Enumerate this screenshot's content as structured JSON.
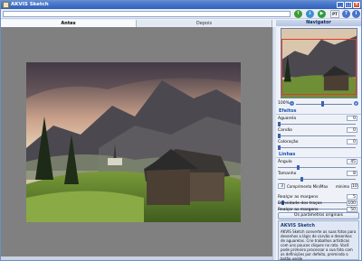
{
  "window": {
    "title": "AKVIS Sketch"
  },
  "toolbar": {
    "path_value": "",
    "pt_label": "PT"
  },
  "tabs": {
    "before": "Antes",
    "after": "Depois"
  },
  "navigator": {
    "title": "Navigator"
  },
  "zoom": {
    "level": "100%",
    "level_fraction": 0.46
  },
  "effects": {
    "title": "Efeitos",
    "params": [
      {
        "label": "Aguarela",
        "value": "0",
        "fraction": 0.0
      },
      {
        "label": "Carvão",
        "value": "0",
        "fraction": 0.0
      },
      {
        "label": "Coloração",
        "value": "0",
        "fraction": 0.0
      }
    ]
  },
  "lines": {
    "title": "Linhas",
    "params": [
      {
        "label": "Ângulo",
        "value": "45",
        "fraction": 0.25
      },
      {
        "label": "Tamanho",
        "value": "8",
        "fraction": 0.3
      }
    ],
    "length_row": {
      "min_value": "3",
      "label": "Comprimento Min/Max",
      "max_label": "mínimo",
      "max_value": "10"
    },
    "more_params": [
      {
        "label": "Realçar as margens",
        "value": "5",
        "fraction": 0.05
      },
      {
        "label": "Densidade dos traços",
        "value": "100",
        "fraction": 1.0
      },
      {
        "label": "Realçar as margens",
        "value": "50",
        "fraction": 0.5
      }
    ]
  },
  "restore_button": "Os parâmetros originais",
  "help": {
    "title": "AKVIS Sketch",
    "text": "AKVIS Sketch converte as suas fotos para desenhos a lápis de carvão e desenhos de aguarelas. Crie trabalhos artísticos com uns poucos cliques no rato. Você pode primeiro processar a sua foto com as definições por defeito, premindo o botão verde"
  },
  "colors": {
    "titlebar": "#2f5fb8",
    "accent": "#1d4fa8",
    "canvas_bg": "#808080",
    "navigator_frame": "#e03a2a"
  }
}
